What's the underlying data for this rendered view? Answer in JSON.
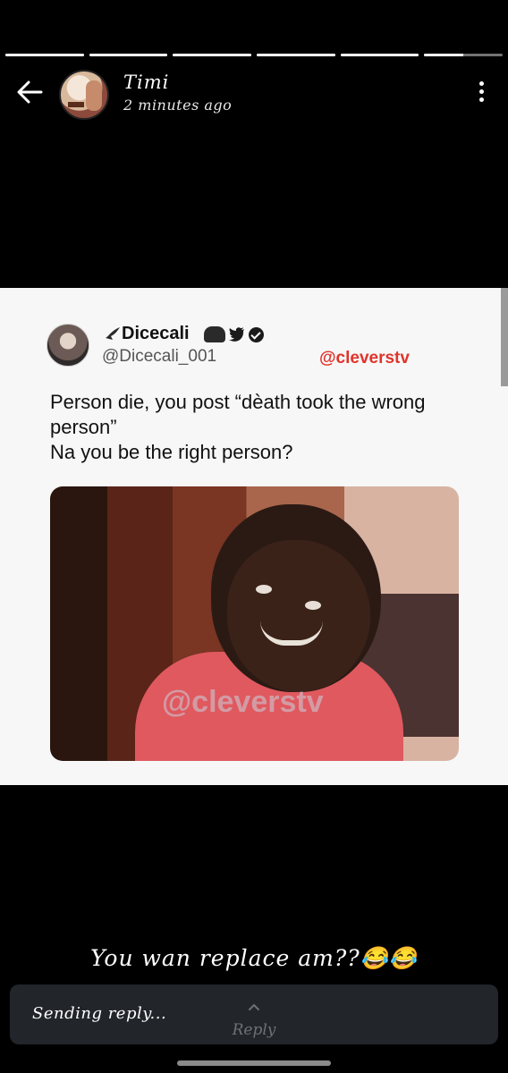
{
  "story": {
    "segments": 6,
    "progress": [
      1,
      1,
      1,
      1,
      1,
      0.5
    ]
  },
  "header": {
    "name": "Timi",
    "time": "2 minutes ago",
    "back_icon": "back-arrow-icon",
    "menu_icon": "more-vertical-icon"
  },
  "tweet": {
    "display_name": "Dicecali",
    "handle": "@Dicecali_001",
    "watermark_tag": "@cleverstv",
    "lines": [
      "Person die, you post “dèath took the wrong person”",
      "Na you be the right person?"
    ],
    "image_watermark": "@cleverstv"
  },
  "caption": "You wan replace am??😂😂",
  "reply": {
    "status": "Sending reply...",
    "label": "Reply",
    "chevron_icon": "chevron-up-icon"
  }
}
